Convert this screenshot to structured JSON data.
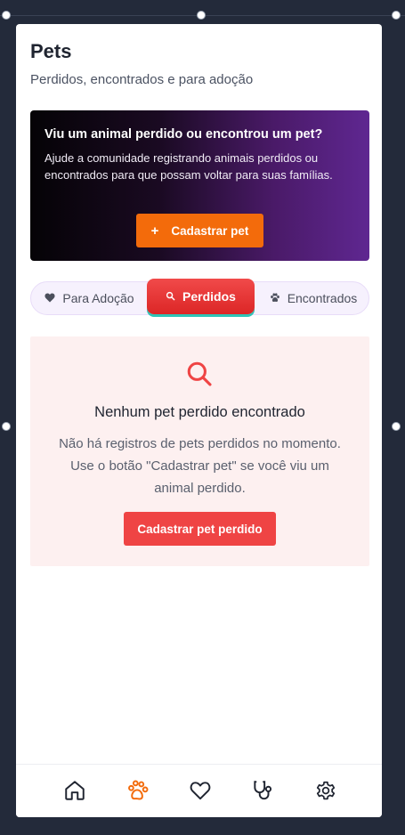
{
  "header": {
    "title": "Pets",
    "subtitle": "Perdidos, encontrados e para adoção"
  },
  "banner": {
    "heading": "Viu um animal perdido ou encontrou um pet?",
    "text": "Ajude a comunidade registrando animais perdidos ou encontrados para que possam voltar para suas famílias.",
    "button_label": "Cadastrar pet",
    "button_icon": "+"
  },
  "tabs": [
    {
      "label": "Para Adoção",
      "icon": "heart-icon",
      "active": false
    },
    {
      "label": "Perdidos",
      "icon": "search-icon",
      "active": true
    },
    {
      "label": "Encontrados",
      "icon": "paw-icon",
      "active": false
    }
  ],
  "empty_state": {
    "icon": "search-icon",
    "title": "Nenhum pet perdido encontrado",
    "text": "Não há registros de pets perdidos no momento. Use o botão \"Cadastrar pet\" se você viu um animal perdido.",
    "button_label": "Cadastrar pet perdido"
  },
  "bottom_nav": [
    {
      "icon": "home-icon",
      "active": false
    },
    {
      "icon": "paw-icon",
      "active": true
    },
    {
      "icon": "heart-icon",
      "active": false
    },
    {
      "icon": "stethoscope-icon",
      "active": false
    },
    {
      "icon": "gear-icon",
      "active": false
    }
  ],
  "colors": {
    "accent_orange": "#f36b0b",
    "accent_red": "#ef4444",
    "banner_gradient_start": "#050306",
    "banner_gradient_end": "#5f2791",
    "tab_bar_bg": "#f6f1fd",
    "empty_card_bg": "#fdf0f0"
  }
}
